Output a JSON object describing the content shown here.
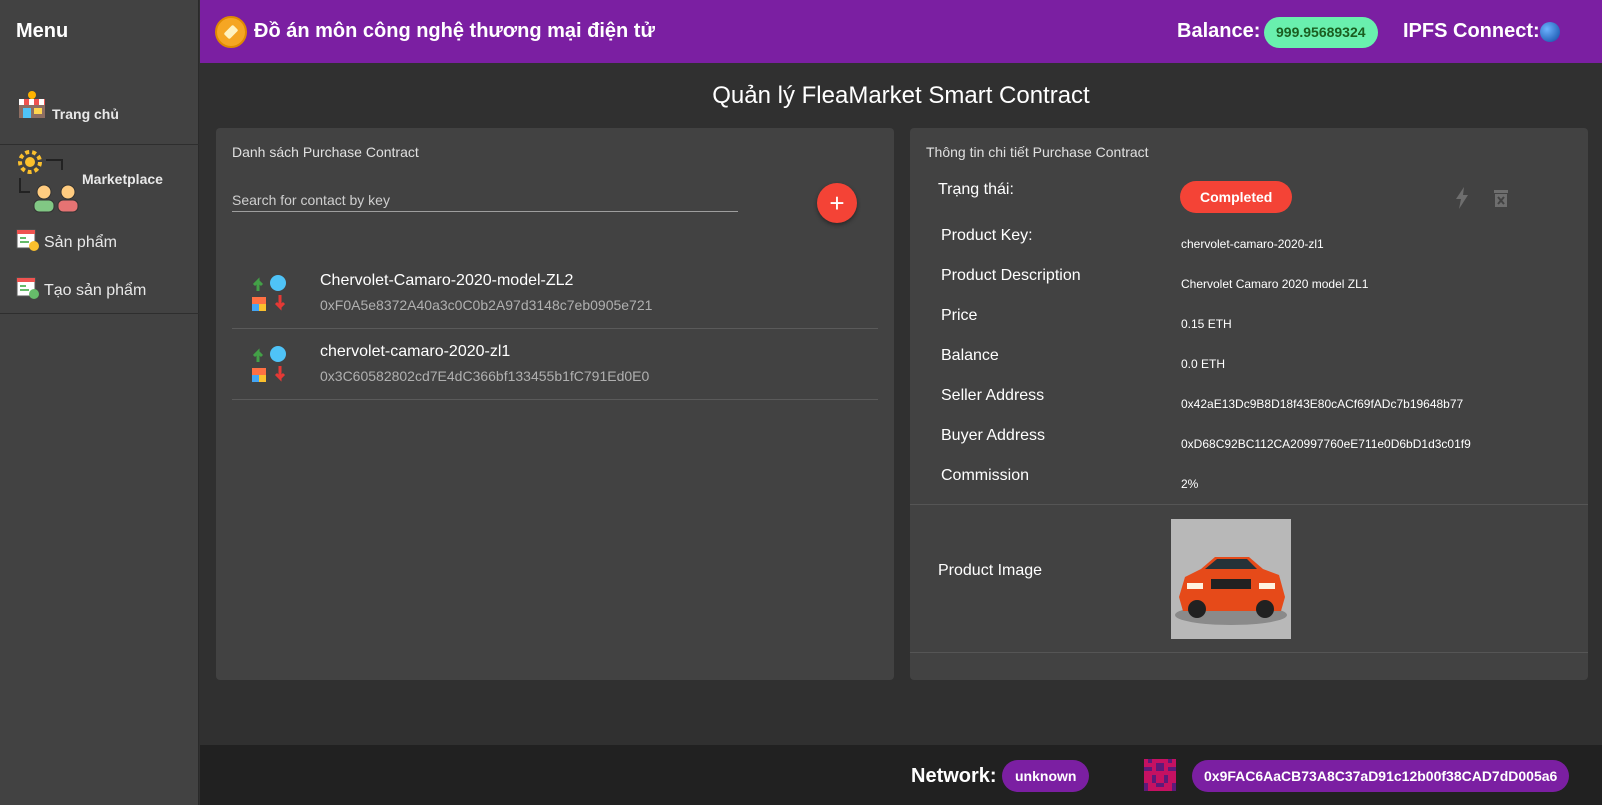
{
  "sidebar": {
    "title": "Menu",
    "items": [
      {
        "label": "Trang chủ",
        "icon": "store-icon"
      },
      {
        "label": "Marketplace",
        "icon": "marketplace-people-icon"
      },
      {
        "label": "Sản phẩm",
        "icon": "products-icon"
      },
      {
        "label": "Tạo sản phẩm",
        "icon": "create-product-icon"
      }
    ]
  },
  "header": {
    "title": "Đồ án môn công nghệ thương mại điện tử",
    "balance_label": "Balance:",
    "balance_value": "999.95689324",
    "ipfs_label": "IPFS Connect:",
    "ipfs_status_color": "#1565c0"
  },
  "page": {
    "title": "Quản lý FleaMarket Smart Contract"
  },
  "list_panel": {
    "title": "Danh sách Purchase Contract",
    "search_placeholder": "Search for contact by key",
    "add_label": "+",
    "contracts": [
      {
        "name": "Chervolet-Camaro-2020-model-ZL2",
        "address": "0xF0A5e8372A40a3c0C0b2A97d3148c7eb0905e721"
      },
      {
        "name": "chervolet-camaro-2020-zl1",
        "address": "0x3C60582802cd7E4dC366bf133455b1fC791Ed0E0"
      }
    ]
  },
  "detail_panel": {
    "title": "Thông tin chi tiết Purchase Contract",
    "status_label": "Trạng thái:",
    "status_value": "Completed",
    "status_color": "#f44336",
    "fields": [
      {
        "label": "Product Key:",
        "value": "chervolet-camaro-2020-zl1"
      },
      {
        "label": "Product Description",
        "value": "Chervolet Camaro 2020 model ZL1"
      },
      {
        "label": "Price",
        "value": "0.15 ETH"
      },
      {
        "label": "Balance",
        "value": "0.0 ETH"
      },
      {
        "label": "Seller Address",
        "value": "0x42aE13Dc9B8D18f43E80cACf69fADc7b19648b77"
      },
      {
        "label": "Buyer Address",
        "value": "0xD68C92BC112CA20997760eE711e0D6bD1d3c01f9"
      },
      {
        "label": "Commission",
        "value": "2%"
      }
    ],
    "image_label": "Product Image"
  },
  "footer": {
    "network_label": "Network:",
    "network_value": "unknown",
    "account_address": "0x9FAC6AaCB73A8C37aD91c12b00f38CAD7dD005a6"
  },
  "colors": {
    "brand_purple": "#7b1fa2",
    "balance_green": "#69f0ae",
    "accent_red": "#f44336"
  }
}
